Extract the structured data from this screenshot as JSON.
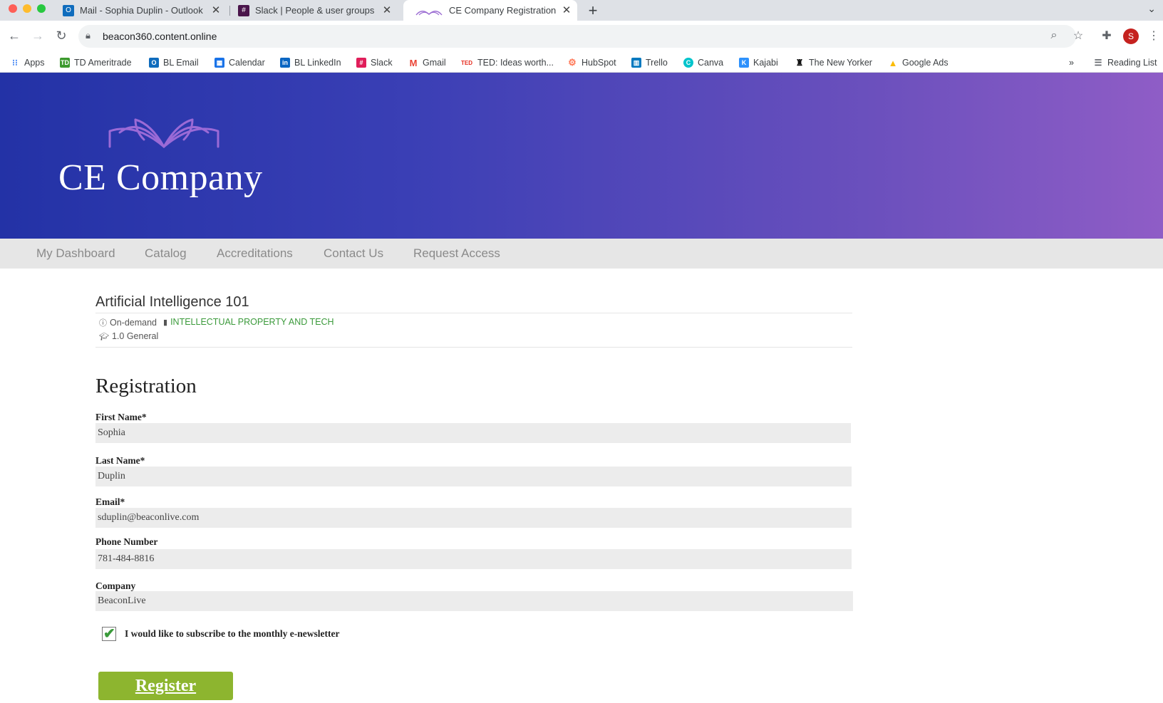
{
  "browser": {
    "tabs": [
      {
        "title": "Mail - Sophia Duplin - Outlook",
        "icon": "outlook-icon",
        "active": false
      },
      {
        "title": "Slack | People & user groups |",
        "icon": "slack-icon",
        "active": false
      },
      {
        "title": "CE Company Registration",
        "icon": "ce-company-book-icon",
        "active": true
      }
    ],
    "url": "beacon360.content.online",
    "profile_initial": "S",
    "bookmarks": [
      {
        "label": "Apps",
        "icon": "apps-grid-icon"
      },
      {
        "label": "TD Ameritrade",
        "icon": "td-ameritrade-icon"
      },
      {
        "label": "BL Email",
        "icon": "outlook-icon"
      },
      {
        "label": "Calendar",
        "icon": "calendar-icon"
      },
      {
        "label": "BL LinkedIn",
        "icon": "linkedin-icon"
      },
      {
        "label": "Slack",
        "icon": "slack-icon"
      },
      {
        "label": "Gmail",
        "icon": "gmail-icon"
      },
      {
        "label": "TED: Ideas worth...",
        "icon": "ted-icon"
      },
      {
        "label": "HubSpot",
        "icon": "hubspot-icon"
      },
      {
        "label": "Trello",
        "icon": "trello-icon"
      },
      {
        "label": "Canva",
        "icon": "canva-icon"
      },
      {
        "label": "Kajabi",
        "icon": "kajabi-icon"
      },
      {
        "label": "The New Yorker",
        "icon": "new-yorker-icon"
      },
      {
        "label": "Google Ads",
        "icon": "google-ads-icon"
      }
    ],
    "overflow": "»",
    "reading_list": "Reading List"
  },
  "site": {
    "logo_text": "CE Company",
    "nav": [
      "My Dashboard",
      "Catalog",
      "Accreditations",
      "Contact Us",
      "Request Access"
    ]
  },
  "course": {
    "title": "Artificial Intelligence 101",
    "format": "On-demand",
    "category": "INTELLECTUAL PROPERTY AND TECH",
    "credits": "1.0 General"
  },
  "form": {
    "heading": "Registration",
    "first_name": {
      "label": "First Name*",
      "value": "Sophia"
    },
    "last_name": {
      "label": "Last Name*",
      "value": "Duplin"
    },
    "email": {
      "label": "Email*",
      "value": "sduplin@beaconlive.com"
    },
    "phone": {
      "label": "Phone Number",
      "value": "781-484-8816"
    },
    "company": {
      "label": "Company",
      "value": "BeaconLive"
    },
    "newsletter": {
      "label": "I would like to subscribe to the monthly e-newsletter",
      "checked": true
    },
    "submit_label": "Register"
  },
  "colors": {
    "hero_start": "#2332a6",
    "hero_end": "#8f5dc6",
    "register_button": "#8db52f",
    "category_green": "#3b9a3b"
  }
}
